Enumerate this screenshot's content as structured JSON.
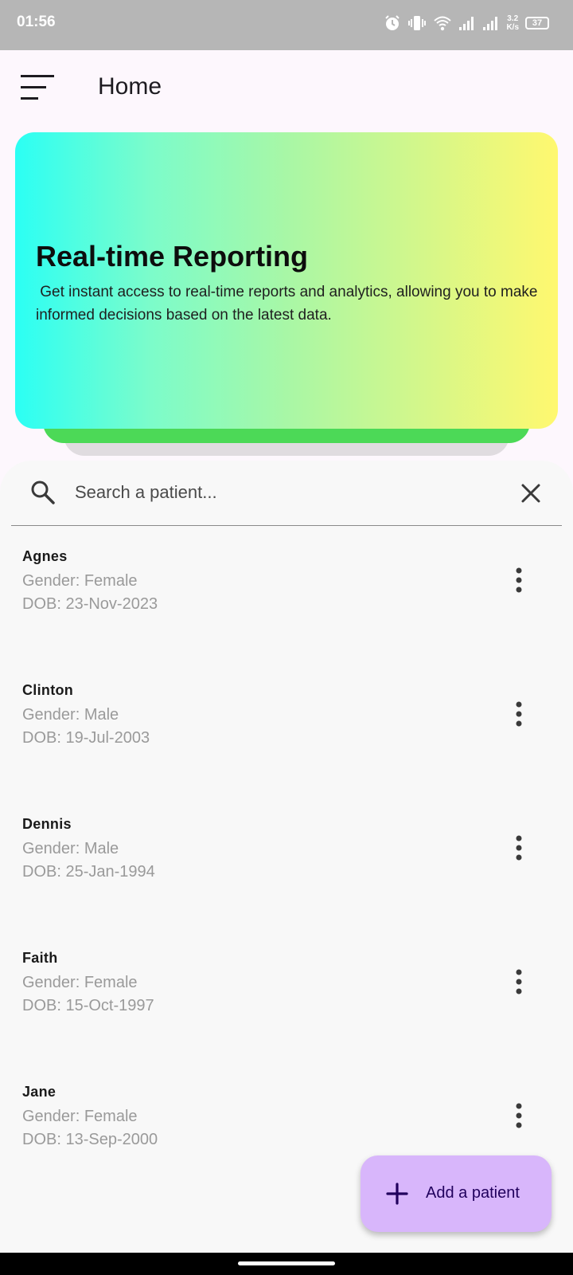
{
  "status_bar": {
    "time": "01:56",
    "net_speed_value": "3.2",
    "net_speed_unit": "K/s",
    "battery": "37",
    "icons": [
      "alarm-icon",
      "vibrate-icon",
      "wifi-icon",
      "signal-icon",
      "signal-icon"
    ]
  },
  "app_bar": {
    "title": "Home",
    "menu_icon": "menu-icon"
  },
  "banner": {
    "title": "Real-time Reporting",
    "text": " Get instant access to real-time reports and analytics, allowing you to make informed decisions based on the latest data.",
    "gradient": [
      "#2bfff4",
      "#fff86f"
    ],
    "accent_back": "#4cd957"
  },
  "search": {
    "placeholder": "Search a patient...",
    "value": "",
    "icon": "search-icon",
    "clear_icon": "close-icon"
  },
  "patients": [
    {
      "name": "Agnes",
      "gender": "Gender: Female",
      "dob": "DOB: 23-Nov-2023"
    },
    {
      "name": "Clinton",
      "gender": "Gender: Male",
      "dob": "DOB: 19-Jul-2003"
    },
    {
      "name": "Dennis",
      "gender": "Gender: Male",
      "dob": "DOB: 25-Jan-1994"
    },
    {
      "name": "Faith",
      "gender": "Gender: Female",
      "dob": "DOB: 15-Oct-1997"
    },
    {
      "name": "Jane",
      "gender": "Gender: Female",
      "dob": "DOB: 13-Sep-2000"
    }
  ],
  "fab": {
    "label": "Add a patient",
    "icon": "plus-icon",
    "color": "#d8b6fb"
  }
}
